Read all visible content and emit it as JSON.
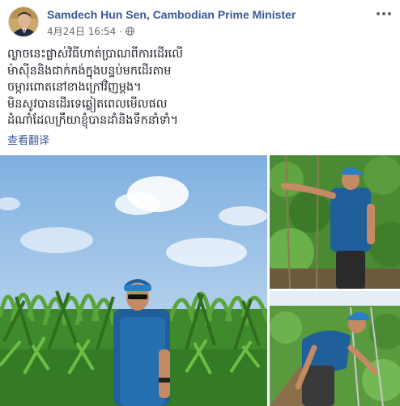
{
  "post": {
    "author": "Samdech Hun Sen, Cambodian Prime Minister",
    "timestamp": "4月24日 16:54",
    "separator": "·",
    "audience_icon": "globe-icon",
    "more_icon": "more-options-icon",
    "text_lines": [
      "ល្ងាចនេះផ្លាស់វិធីហាត់ប្រាណពីការដើរលើ",
      "ម៉ាស៊ីននិងជាក់កង់ក្នុងបន្ទប់មកដើរតាម",
      "ចម្ការពោតនៅខាងក្រៅវិញម្តង។",
      "មិនសូវបានដើរទេឆ្លៀតពេលមើលផល",
      "ដំណាំដែលក្រឹយាខ្ញុំបានដាំនិងទឹកនាំទាំ។"
    ],
    "translate_label": "查看翻译"
  },
  "photos": [
    {
      "name": "cornfield-photo",
      "subject": "man in blue cap standing in cornfield"
    },
    {
      "name": "garden-photo-top",
      "subject": "man touching vines"
    },
    {
      "name": "garden-photo-bottom",
      "subject": "man bending over plants"
    }
  ],
  "colors": {
    "link": "#385898",
    "meta": "#616770",
    "sky": "#9fc3e6",
    "foliage": "#3f8a2c",
    "shirt": "#1f5f9a"
  }
}
